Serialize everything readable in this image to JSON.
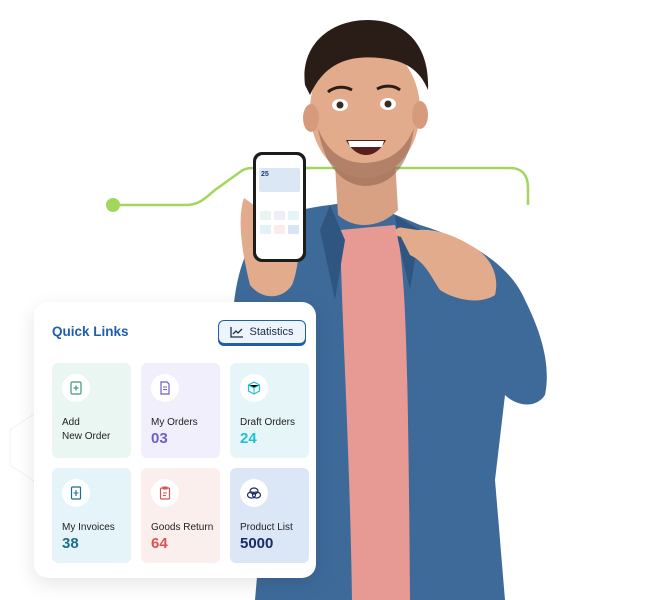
{
  "quick_links": {
    "title": "Quick Links",
    "statistics_label": "Statistics",
    "tiles": [
      {
        "label_line1": "Add",
        "label_line2": "New Order",
        "value": "",
        "bg": "#eaf6f1",
        "value_color": "#333333",
        "icon": "add-order-icon"
      },
      {
        "label_line1": "My Orders",
        "label_line2": "",
        "value": "03",
        "bg": "#f1effb",
        "value_color": "#6c5fc7",
        "icon": "document-icon"
      },
      {
        "label_line1": "Draft Orders",
        "label_line2": "",
        "value": "24",
        "bg": "#e6f5f7",
        "value_color": "#1fbfd6",
        "icon": "box-icon"
      },
      {
        "label_line1": "My Invoices",
        "label_line2": "",
        "value": "38",
        "bg": "#e4f4f9",
        "value_color": "#1c6f8a",
        "icon": "invoice-icon"
      },
      {
        "label_line1": "Goods Return",
        "label_line2": "",
        "value": "64",
        "bg": "#fbefee",
        "value_color": "#d9534f",
        "icon": "return-icon"
      },
      {
        "label_line1": "Product List",
        "label_line2": "",
        "value": "5000",
        "bg": "#dbe6f6",
        "value_color": "#1a2b6a",
        "icon": "products-icon"
      }
    ]
  },
  "phone": {
    "banner_text": "25"
  },
  "colors": {
    "accent": "#1f5ea8",
    "line_green": "#a3d65c"
  }
}
